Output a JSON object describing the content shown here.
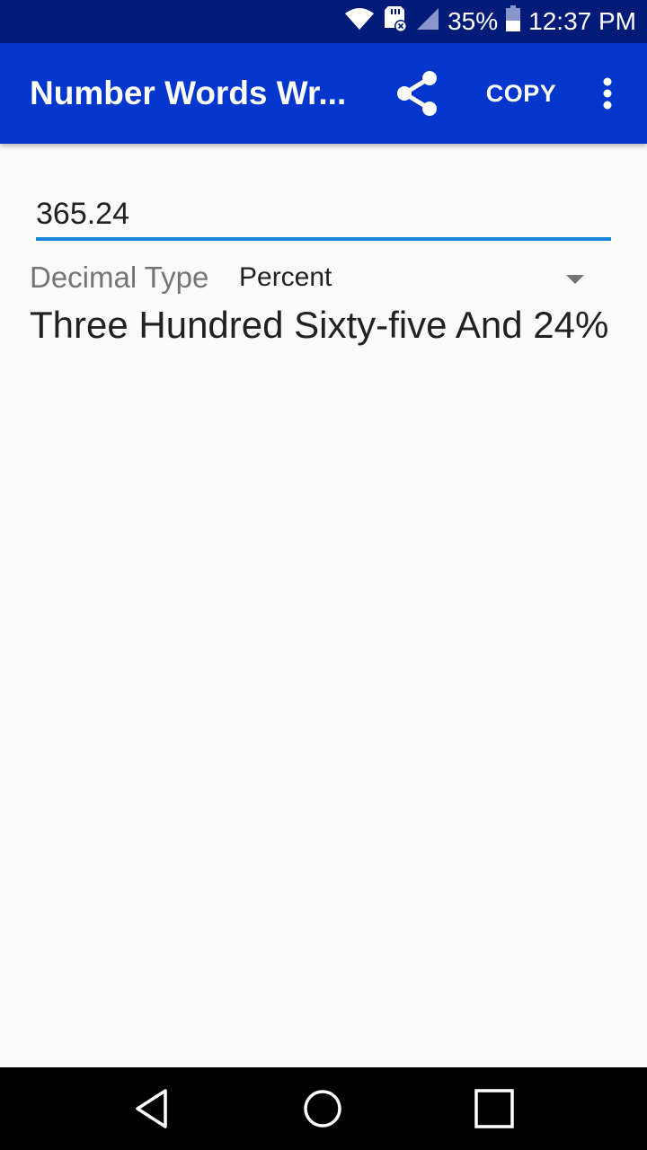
{
  "status_bar": {
    "battery_percent": "35%",
    "time": "12:37 PM",
    "icons": [
      "wifi-icon",
      "sd-card-error-icon",
      "signal-icon",
      "battery-icon"
    ]
  },
  "app_bar": {
    "title": "Number Words Wr...",
    "share_icon": "share-icon",
    "copy_label": "COPY",
    "more_icon": "more-vert-icon"
  },
  "main": {
    "number_input": {
      "value": "365.24"
    },
    "decimal_type": {
      "label": "Decimal Type",
      "selected": "Percent"
    },
    "result": "Three Hundred Sixty-five And 24%"
  },
  "nav_bar": {
    "icons": [
      "back-icon",
      "home-icon",
      "recents-icon"
    ]
  },
  "colors": {
    "status_bar": "#021b79",
    "app_bar": "#0336cc",
    "accent": "#1a86d8",
    "background": "#fafafa"
  }
}
